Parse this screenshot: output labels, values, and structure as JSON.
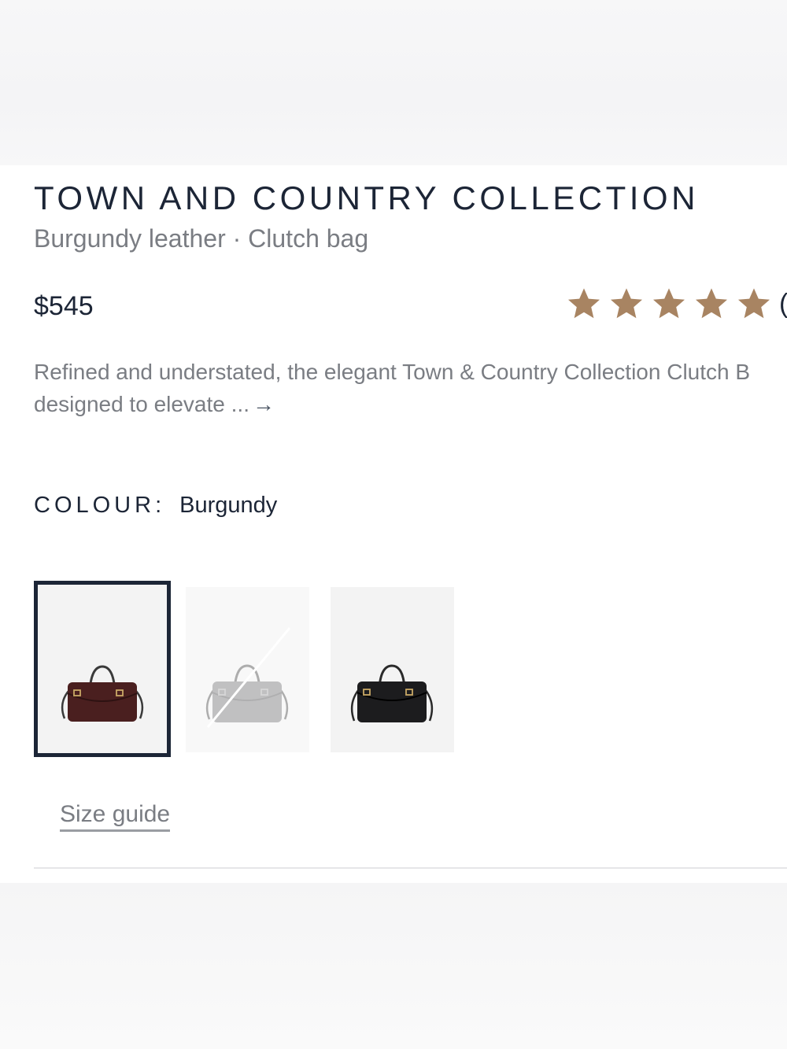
{
  "product": {
    "collection_title": "TOWN AND COUNTRY COLLECTION",
    "subtitle": "Burgundy leather · Clutch bag",
    "price": "$545",
    "rating": {
      "value": 5,
      "max": 5,
      "review_count_visible": "("
    },
    "description": {
      "line1": "Refined and understated, the elegant Town & Country Collection Clutch B",
      "line2": "designed to elevate ...",
      "read_more_icon": "arrow-right-icon",
      "read_more_glyph": "→"
    },
    "colour": {
      "label": "COLOUR:",
      "selected": "Burgundy",
      "swatches": [
        {
          "name": "Burgundy",
          "color": "#4a1f1f",
          "selected": true,
          "unavailable": false
        },
        {
          "name": "Grey",
          "color": "#8e8e90",
          "selected": false,
          "unavailable": true
        },
        {
          "name": "Black",
          "color": "#1c1c1e",
          "selected": false,
          "unavailable": false
        }
      ]
    },
    "size_guide_label": "Size guide"
  },
  "colors": {
    "star": "#a88462",
    "text_dark": "#1c2536",
    "text_muted": "#7a7d83"
  }
}
